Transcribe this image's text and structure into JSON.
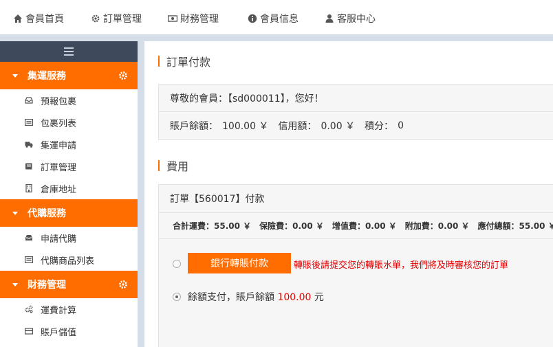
{
  "topnav": {
    "items": [
      {
        "label": "會員首頁",
        "icon": "home-icon"
      },
      {
        "label": "訂單管理",
        "icon": "gear-icon"
      },
      {
        "label": "財務管理",
        "icon": "money-icon"
      },
      {
        "label": "會員信息",
        "icon": "info-icon"
      },
      {
        "label": "客服中心",
        "icon": "user-icon"
      }
    ]
  },
  "sidebar": {
    "groups": [
      {
        "title": "集運服務",
        "items": [
          {
            "label": "預報包裹",
            "icon": "inbox-icon"
          },
          {
            "label": "包裹列表",
            "icon": "list-icon"
          },
          {
            "label": "集運申請",
            "icon": "truck-icon"
          },
          {
            "label": "訂單管理",
            "icon": "book-icon"
          },
          {
            "label": "倉庫地址",
            "icon": "building-icon"
          }
        ]
      },
      {
        "title": "代購服務",
        "items": [
          {
            "label": "申請代購",
            "icon": "inbox-icon"
          },
          {
            "label": "代購商品列表",
            "icon": "list-icon"
          }
        ]
      },
      {
        "title": "財務管理",
        "items": [
          {
            "label": "運費計算",
            "icon": "cogs-icon"
          },
          {
            "label": "賬戶儲值",
            "icon": "card-icon"
          }
        ]
      }
    ]
  },
  "main": {
    "section1": {
      "title": "訂單付款",
      "greeting": "尊敬的會員：【sd000011】，您好！",
      "balance_label": "賬戶餘額：",
      "balance_value": "100.00 ￥",
      "credit_label": "信用額：",
      "credit_value": "0.00 ￥",
      "points_label": "積分：",
      "points_value": "0"
    },
    "section2": {
      "title": "費用",
      "order_line": "訂單【560017】付款",
      "fees": {
        "shipping": "合計運費：55.00 ￥",
        "insurance": "保險費：0.00 ￥",
        "value_added": "增值費：0.00 ￥",
        "surcharge": "附加費：0.00 ￥",
        "total": "應付總額：55.00 ￥"
      },
      "bank_button": "銀行轉賬付款",
      "bank_notice": "轉賬後請提交您的轉賬水單，我們將及時審核您的訂單",
      "balance_pay_text": "餘額支付，賬戶餘額",
      "balance_pay_amount": "100.00",
      "balance_pay_unit": "元"
    }
  },
  "colors": {
    "accent": "#ff6c00",
    "nav_dark": "#3e4a5b",
    "notice_red": "#e20000"
  }
}
